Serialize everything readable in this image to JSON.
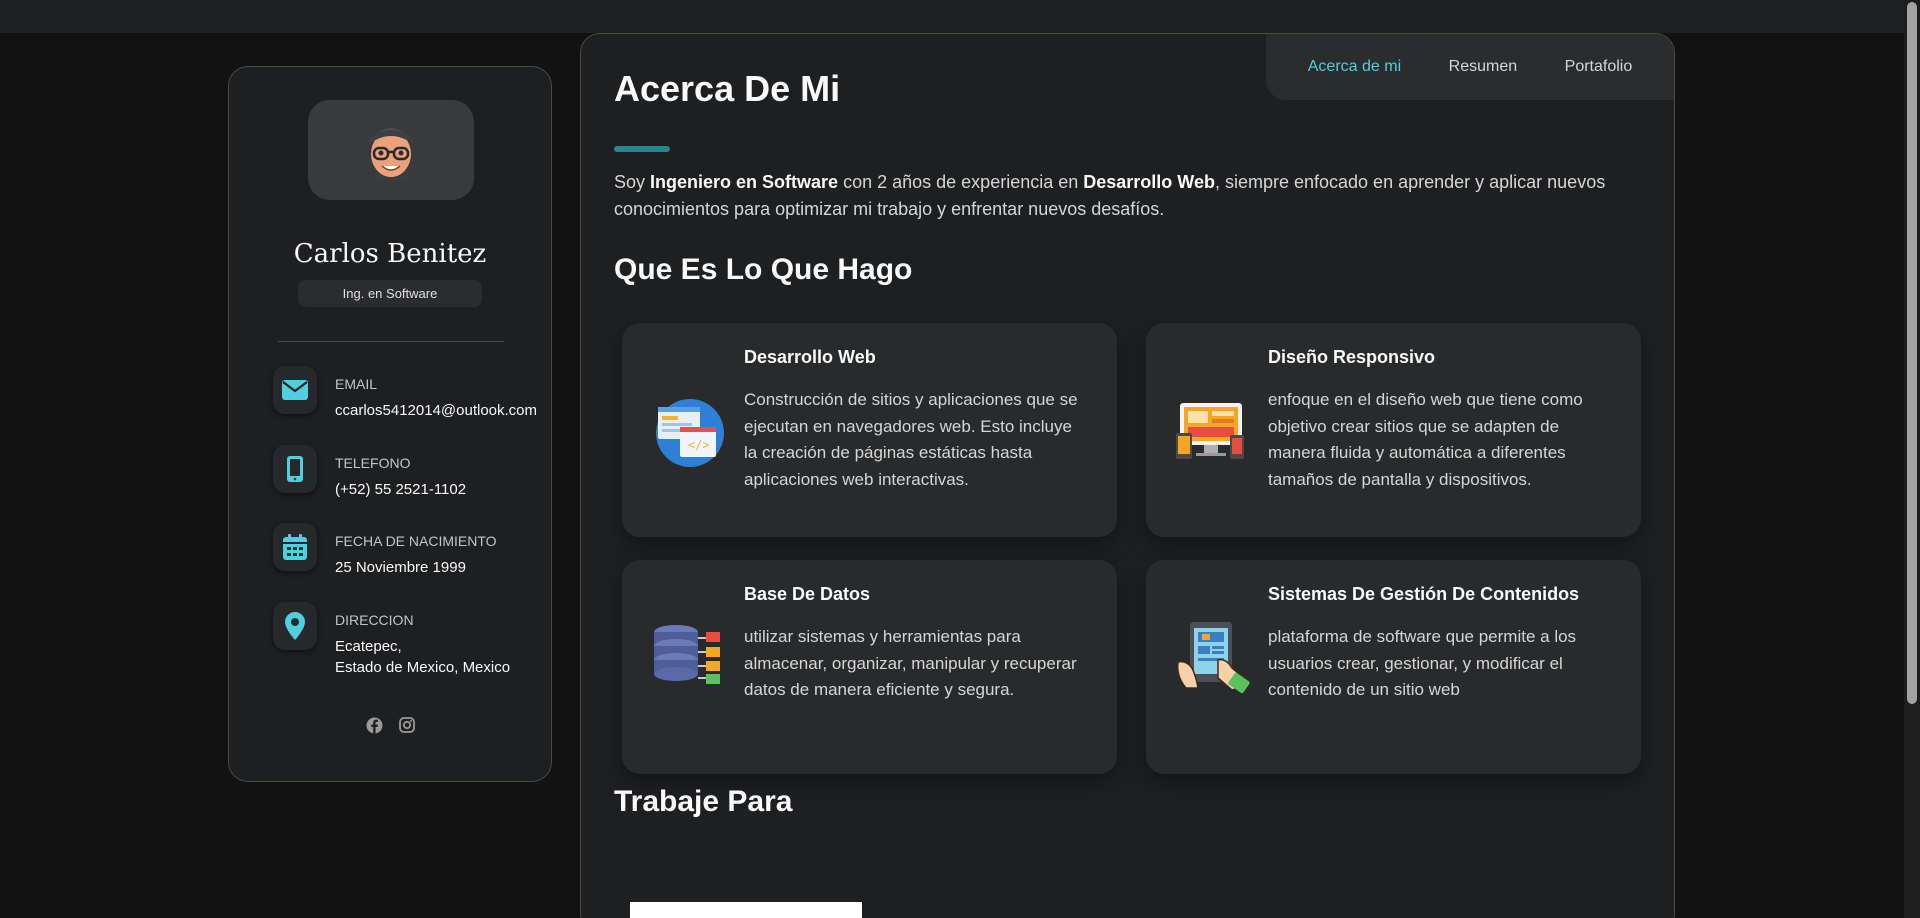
{
  "profile": {
    "name": "Carlos Benitez",
    "role": "Ing. en Software",
    "contacts": [
      {
        "label": "EMAIL",
        "value": "ccarlos5412014@outlook.com",
        "icon": "mail-icon"
      },
      {
        "label": "TELEFONO",
        "value": "(+52) 55 2521-1102",
        "icon": "phone-icon"
      },
      {
        "label": "FECHA DE NACIMIENTO",
        "value": "25 Noviembre 1999",
        "icon": "calendar-icon"
      },
      {
        "label": "DIRECCION",
        "value_line1": "Ecatepec,",
        "value_line2": "Estado de Mexico, Mexico",
        "icon": "location-pin-icon"
      }
    ],
    "socials": [
      "facebook-icon",
      "instagram-icon"
    ]
  },
  "nav": {
    "items": [
      {
        "label": "Acerca de mi",
        "active": true
      },
      {
        "label": "Resumen",
        "active": false
      },
      {
        "label": "Portafolio",
        "active": false
      }
    ]
  },
  "about": {
    "title": "Acerca De Mi",
    "text_1": "Soy ",
    "text_bold_1": "Ingeniero en Software",
    "text_2": " con 2 años de experiencia en ",
    "text_bold_2": "Desarrollo Web",
    "text_3": ", siempre enfocado en aprender y aplicar nuevos conocimientos para optimizar mi trabajo y enfrentar nuevos desafíos."
  },
  "services": {
    "title": "Que Es Lo Que Hago",
    "items": [
      {
        "title": "Desarrollo Web",
        "desc": "Construcción de sitios y aplicaciones que se ejecutan en navegadores web. Esto incluye la creación de páginas estáticas hasta aplicaciones web interactivas.",
        "icon": "web-development-icon"
      },
      {
        "title": "Diseño Responsivo",
        "desc": "enfoque en el diseño web que tiene como objetivo crear sitios que se adapten de manera fluida y automática a diferentes tamaños de pantalla y dispositivos.",
        "icon": "responsive-devices-icon"
      },
      {
        "title": "Base De Datos",
        "desc": "utilizar sistemas y herramientas para almacenar, organizar, manipular y recuperar datos de manera eficiente y segura.",
        "icon": "database-icon"
      },
      {
        "title": "Sistemas De Gestión De Contenidos",
        "desc": "plataforma de software que permite a los usuarios crear, gestionar, y modificar el contenido de un sitio web",
        "icon": "cms-tablet-icon"
      }
    ]
  },
  "work": {
    "title": "Trabaje Para"
  },
  "colors": {
    "accent": "#4fd0df",
    "accent_bar": "#21898f",
    "background": "#121212",
    "card": "#1e1f21"
  }
}
